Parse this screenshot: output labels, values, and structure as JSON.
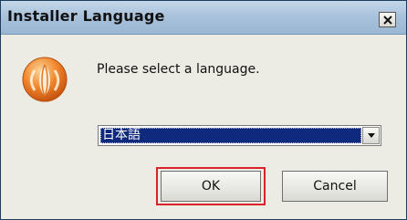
{
  "window": {
    "title": "Installer Language",
    "close_icon": "close-icon"
  },
  "dialog": {
    "app_icon": "installer-logo-icon",
    "message": "Please select a language."
  },
  "language_select": {
    "selected": "日本語",
    "arrow_icon": "chevron-down-icon"
  },
  "buttons": {
    "ok_label": "OK",
    "cancel_label": "Cancel"
  },
  "colors": {
    "highlight": "#d9232a",
    "selection": "#0f2a7c",
    "icon_orange": "#e8741c"
  }
}
